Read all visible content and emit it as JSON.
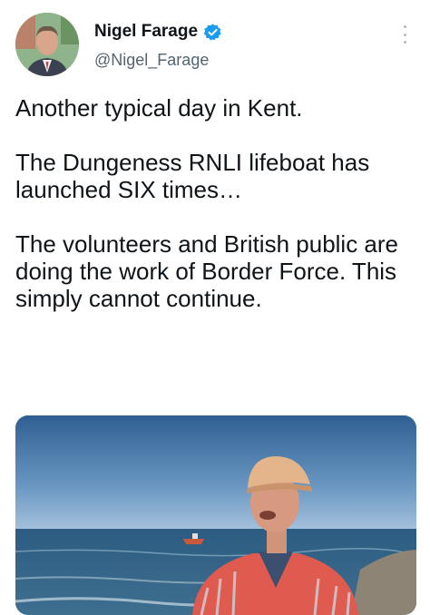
{
  "tweet": {
    "author": {
      "display_name": "Nigel Farage",
      "handle": "@Nigel_Farage",
      "verified": true,
      "avatar_icon": "profile-photo"
    },
    "text_paragraphs": [
      "Another typical day in Kent.",
      "The Dungeness RNLI lifeboat has launched SIX times…",
      "The volunteers and British public are doing the work of Border Force. This simply cannot continue."
    ],
    "more_icon": "more-vertical-icon",
    "verified_color": "#1d9bf0",
    "media": {
      "type": "video-thumbnail"
    }
  }
}
